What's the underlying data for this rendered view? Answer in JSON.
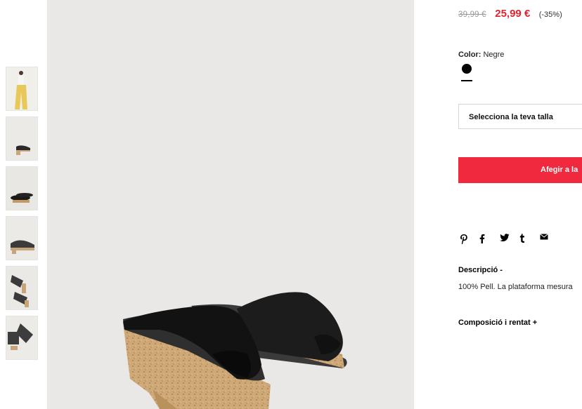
{
  "product": {
    "old_price": "39,99 €",
    "new_price": "25,99 €",
    "discount": "(-35%)",
    "color_label": "Color:",
    "color_value": "Negre",
    "swatch_color": "#000000",
    "size_placeholder": "Selecciona la teva talla",
    "add_button": "Afegir a la",
    "accent_color": "#f0293f",
    "price_color": "#e1232f"
  },
  "share": {
    "icons": [
      "pinterest-icon",
      "facebook-icon",
      "twitter-icon",
      "tumblr-icon",
      "mail-icon"
    ]
  },
  "description": {
    "title": "Descripció  -",
    "text": "100% Pell. La plataforma mesura"
  },
  "composition": {
    "title": "Composició i rentat  +"
  },
  "gallery": {
    "thumbnails": [
      "model-yellow-trousers",
      "shoe-side",
      "shoe-pair-front",
      "shoe-pair-side",
      "shoe-pair-angle",
      "shoe-pair-top"
    ]
  }
}
